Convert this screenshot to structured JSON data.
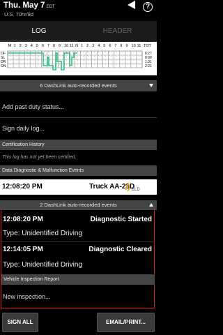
{
  "header": {
    "date": "Thu. May 7",
    "timezone": "EDT",
    "cycle": "U.S. 70hr/8d",
    "back_icon": "back-triangle-icon",
    "help_label": "?"
  },
  "tabs": [
    {
      "label": "LOG",
      "active": true
    },
    {
      "label": "HEADER",
      "active": false
    }
  ],
  "graph": {
    "hours": [
      "M",
      "1",
      "2",
      "3",
      "4",
      "5",
      "6",
      "7",
      "8",
      "9",
      "10",
      "11",
      "N",
      "1",
      "2",
      "3",
      "4",
      "5",
      "6",
      "7",
      "8",
      "9",
      "10",
      "11"
    ],
    "tot_label": "TOT",
    "rows": [
      {
        "label": "OF",
        "total": "8:27"
      },
      {
        "label": "SL",
        "total": "0:00"
      },
      {
        "label": "DR",
        "total": "1:31"
      },
      {
        "label": "ON",
        "total": "2:21"
      }
    ],
    "line_color": "#2ec27e"
  },
  "dashlink_top": "6 DashLink auto-recorded events",
  "actions": {
    "add_past": "Add past duty status...",
    "sign_log": "Sign daily log..."
  },
  "certification": {
    "header": "Certification History",
    "note": "This log has not yet been certified."
  },
  "diagnostics": {
    "header": "Data Diagnostic & Malfunction Events",
    "time": "12:08:20 PM",
    "truck": "Truck AA-23D",
    "eld": "ELD"
  },
  "dashlink_bottom": "2 DashLink auto-recorded events",
  "events": [
    {
      "time": "12:08:20 PM",
      "title": "Diagnostic Started",
      "type": "Type:  Unidentified Driving"
    },
    {
      "time": "12:14:05 PM",
      "title": "Diagnostic Cleared",
      "type": "Type:  Unidentified Driving"
    }
  ],
  "inspection": {
    "header": "Vehicle Inspection Report",
    "new": "New inspection..."
  },
  "footer": {
    "sign_all": "SIGN ALL",
    "email_print": "EMAIL/PRINT..."
  },
  "colors": {
    "highlight_border": "#d42020",
    "band": "#444444",
    "graph_line": "#2ec27e"
  }
}
